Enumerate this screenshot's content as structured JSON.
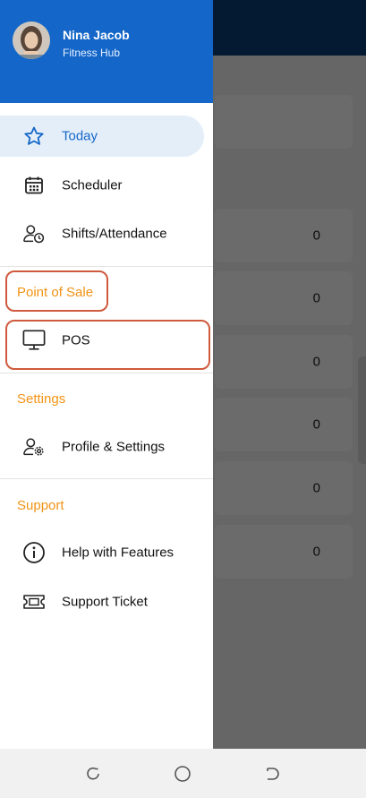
{
  "drawer": {
    "user": {
      "name": "Nina Jacob",
      "organization": "Fitness Hub"
    },
    "items": [
      {
        "key": "today",
        "label": "Today",
        "icon": "star-icon",
        "active": true
      },
      {
        "key": "scheduler",
        "label": "Scheduler",
        "icon": "calendar-icon"
      },
      {
        "key": "shifts",
        "label": "Shifts/Attendance",
        "icon": "user-clock-icon"
      }
    ],
    "sections": [
      {
        "title": "Point of Sale",
        "items": [
          {
            "key": "pos",
            "label": "POS",
            "icon": "monitor-icon"
          }
        ]
      },
      {
        "title": "Settings",
        "items": [
          {
            "key": "profile",
            "label": "Profile & Settings",
            "icon": "user-gear-icon"
          }
        ]
      },
      {
        "title": "Support",
        "items": [
          {
            "key": "help",
            "label": "Help with Features",
            "icon": "info-icon"
          },
          {
            "key": "ticket",
            "label": "Support Ticket",
            "icon": "ticket-icon"
          }
        ]
      }
    ]
  },
  "background": {
    "values": [
      "0",
      "0",
      "0",
      "0",
      "0",
      "0"
    ]
  },
  "colors": {
    "header_blue": "#1467c8",
    "section_orange": "#f29314",
    "active_bg": "#e3eef9",
    "highlight": "#cf5a3d"
  }
}
